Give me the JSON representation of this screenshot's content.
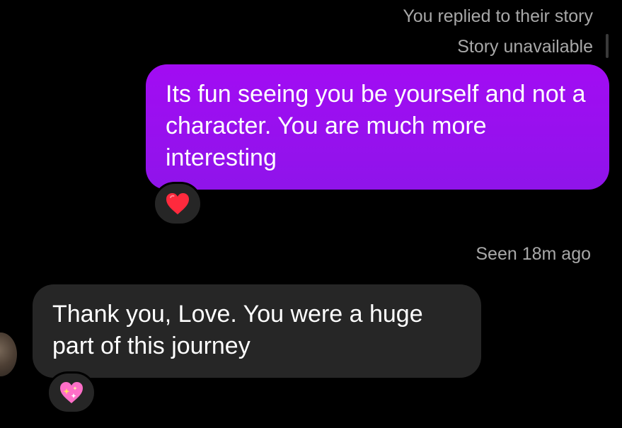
{
  "thread": {
    "reply_context": "You replied to their story",
    "story_status": "Story unavailable",
    "seen_status": "Seen 18m ago"
  },
  "messages": [
    {
      "direction": "outgoing",
      "text": "Its fun seeing you be yourself and not a character. You are much more interesting",
      "reaction_icon": "red-heart",
      "reaction_emoji": "❤️"
    },
    {
      "direction": "incoming",
      "text": "Thank you, Love. You were a huge part of this journey",
      "reaction_icon": "sparkling-heart",
      "reaction_emoji": "💖"
    }
  ],
  "colors": {
    "background": "#000000",
    "outgoing_bubble": "#9b10f0",
    "incoming_bubble": "#262626",
    "meta_text": "#a8a8a8"
  }
}
